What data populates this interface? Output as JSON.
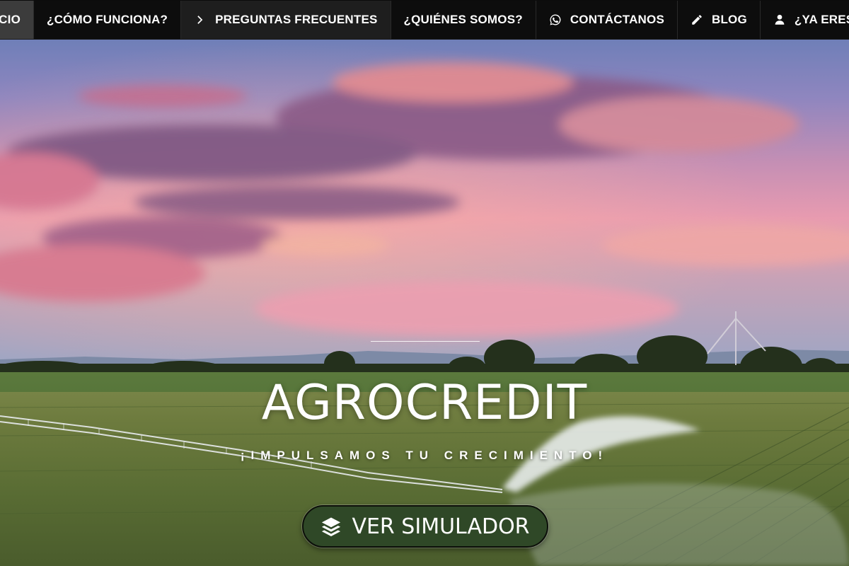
{
  "nav": {
    "items": [
      {
        "label": "INICIO",
        "icon": ""
      },
      {
        "label": "¿CÓMO FUNCIONA?",
        "icon": ""
      },
      {
        "label": "PREGUNTAS FRECUENTES",
        "icon": "chevron-right-icon"
      },
      {
        "label": "¿QUIÉNES SOMOS?",
        "icon": ""
      },
      {
        "label": "CONTÁCTANOS",
        "icon": "whatsapp-icon"
      },
      {
        "label": "BLOG",
        "icon": "pencil-icon"
      },
      {
        "label": "¿YA ERES CLIENTE?",
        "icon": "user-icon"
      }
    ]
  },
  "hero": {
    "title": "AGROCREDIT",
    "tagline": "¡IMPULSAMOS TU CRECIMIENTO!",
    "button_label": "VER SIMULADOR",
    "button_icon": "layers-icon"
  },
  "colors": {
    "nav_bg": "#0d0d0d",
    "nav_active_bg": "#3c3c3c",
    "button_bg": "#2f4827",
    "text": "#ffffff"
  }
}
